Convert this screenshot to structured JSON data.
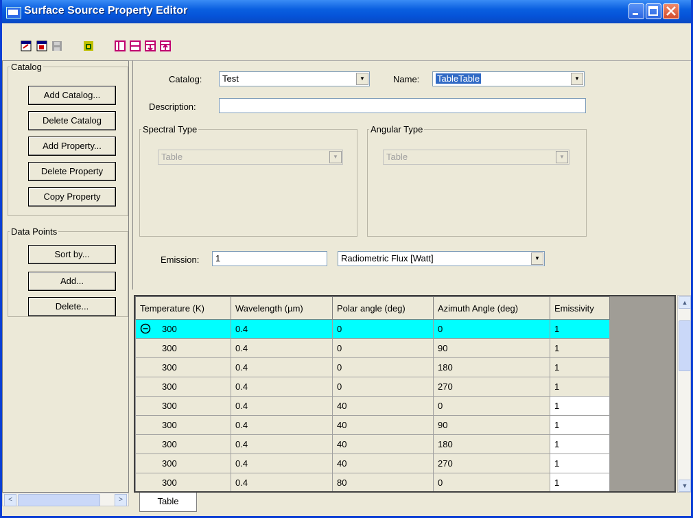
{
  "window": {
    "title": "Surface Source Property Editor"
  },
  "catalog_group": {
    "legend": "Catalog",
    "buttons": [
      "Add Catalog...",
      "Delete Catalog",
      "Add Property...",
      "Delete Property",
      "Copy Property"
    ]
  },
  "datapoints_group": {
    "legend": "Data Points",
    "buttons": [
      "Sort by...",
      "Add...",
      "Delete..."
    ]
  },
  "form": {
    "catalog_label": "Catalog:",
    "catalog_value": "Test",
    "name_label": "Name:",
    "name_value": "TableTable",
    "description_label": "Description:",
    "description_value": "",
    "spectral_legend": "Spectral Type",
    "spectral_value": "Table",
    "angular_legend": "Angular Type",
    "angular_value": "Table",
    "emission_label": "Emission:",
    "emission_value": "1",
    "emission_unit": "Radiometric Flux [Watt]"
  },
  "table": {
    "columns": [
      "Temperature (K)",
      "Wavelength (µm)",
      "Polar angle (deg)",
      "Azimuth Angle (deg)",
      "Emissivity"
    ],
    "rows": [
      [
        "300",
        "0.4",
        "0",
        "0",
        "1"
      ],
      [
        "300",
        "0.4",
        "0",
        "90",
        "1"
      ],
      [
        "300",
        "0.4",
        "0",
        "180",
        "1"
      ],
      [
        "300",
        "0.4",
        "0",
        "270",
        "1"
      ],
      [
        "300",
        "0.4",
        "40",
        "0",
        "1"
      ],
      [
        "300",
        "0.4",
        "40",
        "90",
        "1"
      ],
      [
        "300",
        "0.4",
        "40",
        "180",
        "1"
      ],
      [
        "300",
        "0.4",
        "40",
        "270",
        "1"
      ],
      [
        "300",
        "0.4",
        "80",
        "0",
        "1"
      ]
    ]
  },
  "tabs": [
    "Table"
  ]
}
